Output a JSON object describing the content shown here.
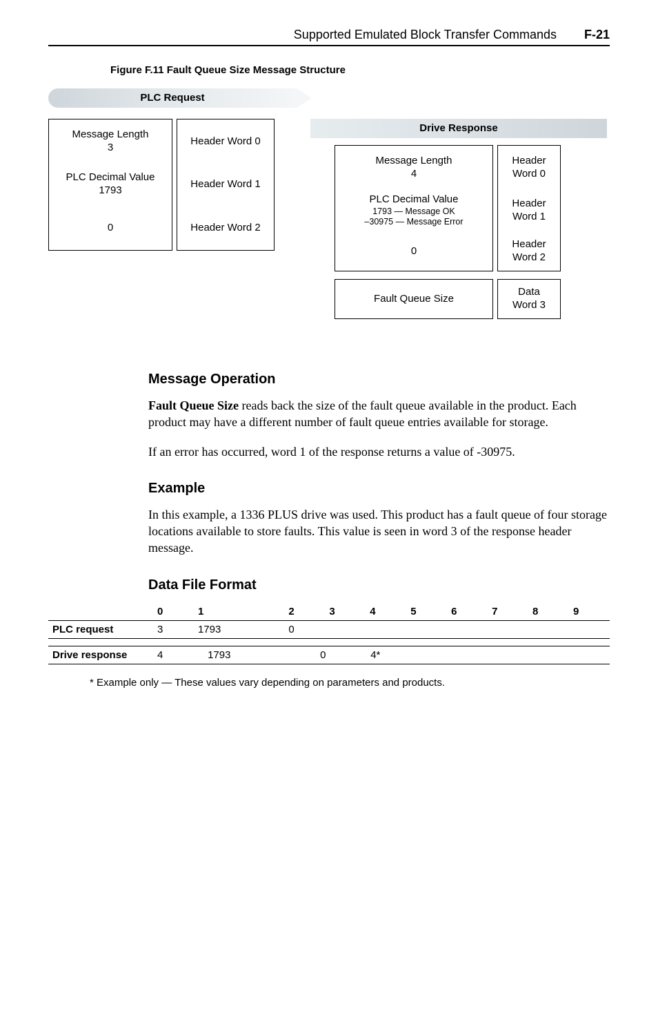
{
  "header": {
    "title": "Supported Emulated Block Transfer Commands",
    "page": "F-21"
  },
  "figure": {
    "caption": "Figure F.11   Fault Queue Size Message Structure"
  },
  "diagram": {
    "plc_title": "PLC Request",
    "drive_title": "Drive Response",
    "plc_rows": [
      {
        "left_line1": "Message Length",
        "left_line2": "3",
        "right": "Header Word 0"
      },
      {
        "left_line1": "PLC Decimal Value",
        "left_line2": "1793",
        "right": "Header Word 1"
      },
      {
        "left_line1": "0",
        "left_line2": "",
        "right": "Header Word 2"
      }
    ],
    "drive_rows": [
      {
        "left_line1": "Message Length",
        "left_line2": "4",
        "left_line3": "",
        "right_line1": "Header",
        "right_line2": "Word 0"
      },
      {
        "left_line1": "PLC Decimal Value",
        "left_line2": "1793 — Message OK",
        "left_line3": "–30975 — Message Error",
        "right_line1": "Header",
        "right_line2": "Word 1"
      },
      {
        "left_line1": "0",
        "left_line2": "",
        "left_line3": "",
        "right_line1": "Header",
        "right_line2": "Word 2"
      },
      {
        "left_line1": "Fault Queue Size",
        "left_line2": "",
        "left_line3": "",
        "right_line1": "Data",
        "right_line2": "Word 3"
      }
    ]
  },
  "sections": {
    "msg_op_heading": "Message Operation",
    "msg_op_p1_lead": "Fault Queue Size",
    "msg_op_p1_rest": " reads back the size of the fault queue available in the product. Each product may have a different number of fault queue entries available for storage.",
    "msg_op_p2": "If an error has occurred, word 1 of the response returns a value of -30975.",
    "example_heading": "Example",
    "example_p": "In this example, a 1336 PLUS drive was used. This product has a fault queue of four storage locations available to store faults. This value is seen in word 3 of the response header message.",
    "dff_heading": "Data File Format"
  },
  "tables": {
    "columns": [
      "0",
      "1",
      "2",
      "3",
      "4",
      "5",
      "6",
      "7",
      "8",
      "9"
    ],
    "plc_label": "PLC request",
    "plc_cells": [
      "3",
      "1793",
      "0",
      "",
      "",
      "",
      "",
      "",
      "",
      ""
    ],
    "drive_label": "Drive response",
    "drive_cells": [
      "4",
      "1793",
      "0",
      "4*",
      "",
      "",
      "",
      "",
      "",
      ""
    ]
  },
  "footnote": "* Example only — These values vary depending on parameters and products."
}
